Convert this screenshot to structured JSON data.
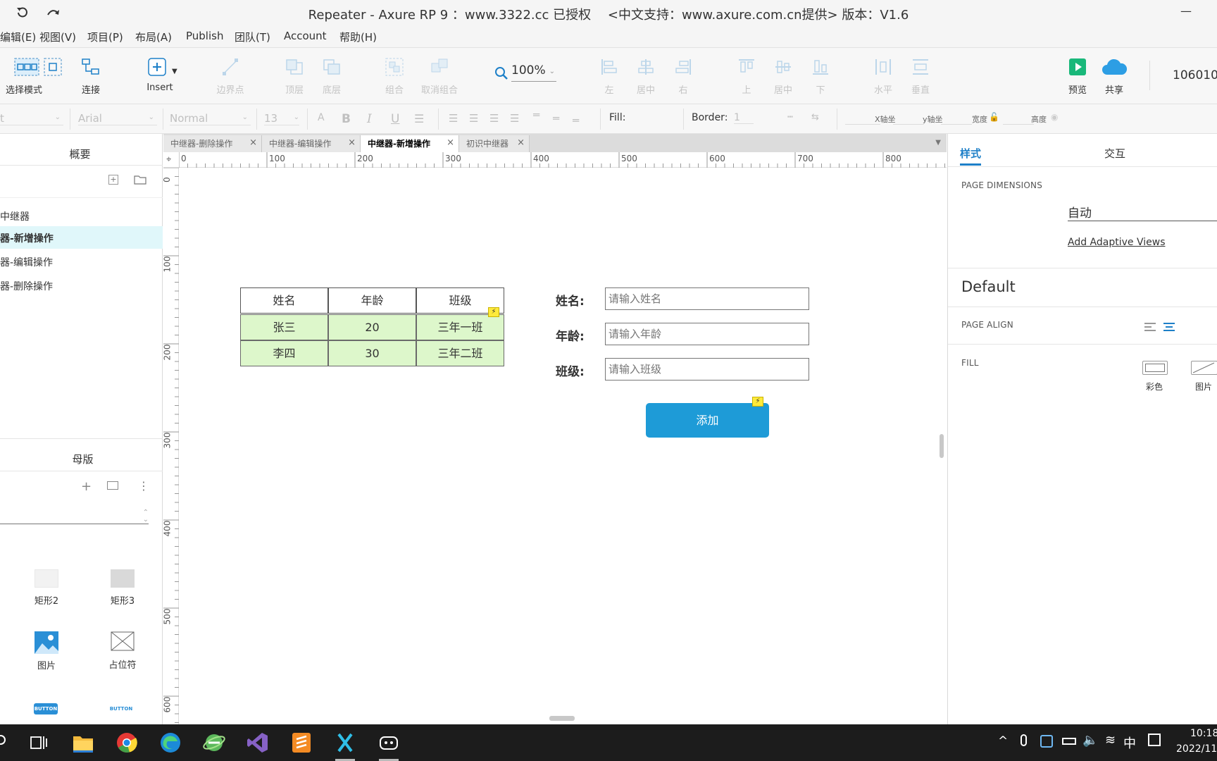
{
  "window": {
    "title": "Repeater - Axure RP 9 ：www.3322.cc 已授权 　<中文支持：www.axure.com.cn提供> 版本：V1.6",
    "minimize": "—"
  },
  "menu": [
    "编辑(E)",
    "视图(V)",
    "项目(P)",
    "布局(A)",
    "Publish",
    "团队(T)",
    "Account",
    "帮助(H)"
  ],
  "toolbar": {
    "select_mode": "选择模式",
    "connect": "连接",
    "insert": "Insert",
    "edge_points": "边界点",
    "top_layer": "顶层",
    "bottom_layer": "底层",
    "group": "组合",
    "ungroup": "取消组合",
    "zoom": "100%",
    "align_left": "左",
    "align_center": "居中",
    "align_right": "右",
    "align_top": "上",
    "align_middle": "居中",
    "align_bottom": "下",
    "dist_horizontal": "水平",
    "dist_vertical": "垂直",
    "preview": "预览",
    "share": "共享",
    "user_id": "106010"
  },
  "formatbar": {
    "style_select": "t",
    "font": "Arial",
    "weight": "Normal",
    "size": "13",
    "fill_label": "Fill:",
    "border_label": "Border:",
    "border_value": "1",
    "x_label": "X轴坐",
    "y_label": "y轴坐",
    "width_label": "宽度",
    "height_label": "高度"
  },
  "left_panel": {
    "outline_title": "概要",
    "pages": [
      "中继器",
      "器-新增操作",
      "器-编辑操作",
      "器-删除操作"
    ],
    "selected_page_index": 1,
    "masters_title": "母版",
    "widgets": [
      "矩形2",
      "矩形3",
      "图片",
      "占位符"
    ],
    "button_widget_text": "BUTTON"
  },
  "tabs": [
    {
      "label": "中继器-删除操作",
      "active": false
    },
    {
      "label": "中继器-编辑操作",
      "active": false
    },
    {
      "label": "中继器-新增操作",
      "active": true
    },
    {
      "label": "初识中继器",
      "active": false
    }
  ],
  "ruler": {
    "h": [
      "0",
      "100",
      "200",
      "300",
      "400",
      "500",
      "600",
      "700",
      "800"
    ],
    "v": [
      "0",
      "100",
      "200",
      "300",
      "400",
      "500",
      "600"
    ]
  },
  "repeater": {
    "headers": [
      "姓名",
      "年龄",
      "班级"
    ],
    "rows": [
      [
        "张三",
        "20",
        "三年一班"
      ],
      [
        "李四",
        "30",
        "三年二班"
      ]
    ]
  },
  "form": {
    "name_label": "姓名:",
    "name_placeholder": "请输入姓名",
    "age_label": "年龄:",
    "age_placeholder": "请输入年龄",
    "class_label": "班级:",
    "class_placeholder": "请输入班级",
    "add_button": "添加"
  },
  "right_panel": {
    "tab_style": "样式",
    "tab_interaction": "交互",
    "page_dimensions_label": "PAGE DIMENSIONS",
    "page_dimensions_value": "自动",
    "adaptive_link": "Add Adaptive Views",
    "default_label": "Default",
    "page_align_label": "PAGE ALIGN",
    "fill_label": "FILL",
    "fill_color": "彩色",
    "fill_image": "图片"
  },
  "taskbar": {
    "ime": "中",
    "time": "10:18",
    "date": "2022/11"
  },
  "colors": {
    "accent": "#1e9bd7",
    "row_fill": "#ddf7cb",
    "selected_page": "#e0f7fa",
    "taskbar": "#1c1c1c"
  }
}
